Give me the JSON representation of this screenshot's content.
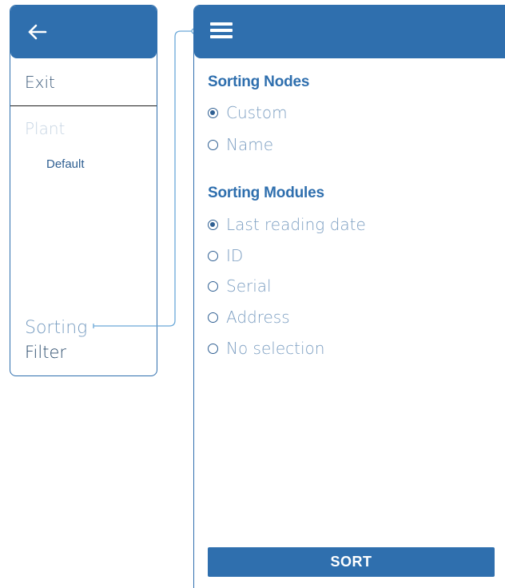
{
  "drawer": {
    "back_icon": "arrow-left-icon",
    "items": {
      "exit": "Exit",
      "plant": "Plant",
      "default": "Default",
      "sorting": "Sorting",
      "filter": "Filter"
    }
  },
  "panel": {
    "menu_icon": "hamburger-menu-icon",
    "sorting_nodes": {
      "title": "Sorting Nodes",
      "options": [
        {
          "label": "Custom",
          "selected": true
        },
        {
          "label": "Name",
          "selected": false
        }
      ]
    },
    "sorting_modules": {
      "title": "Sorting Modules",
      "options": [
        {
          "label": "Last reading date",
          "selected": true
        },
        {
          "label": "ID",
          "selected": false
        },
        {
          "label": "Serial",
          "selected": false
        },
        {
          "label": "Address",
          "selected": false
        },
        {
          "label": "No selection",
          "selected": false
        }
      ]
    },
    "sort_button": "SORT"
  },
  "colors": {
    "primary": "#2f6fae",
    "muted_text": "#7d9fc2",
    "disabled_text": "#c7d5e3"
  }
}
